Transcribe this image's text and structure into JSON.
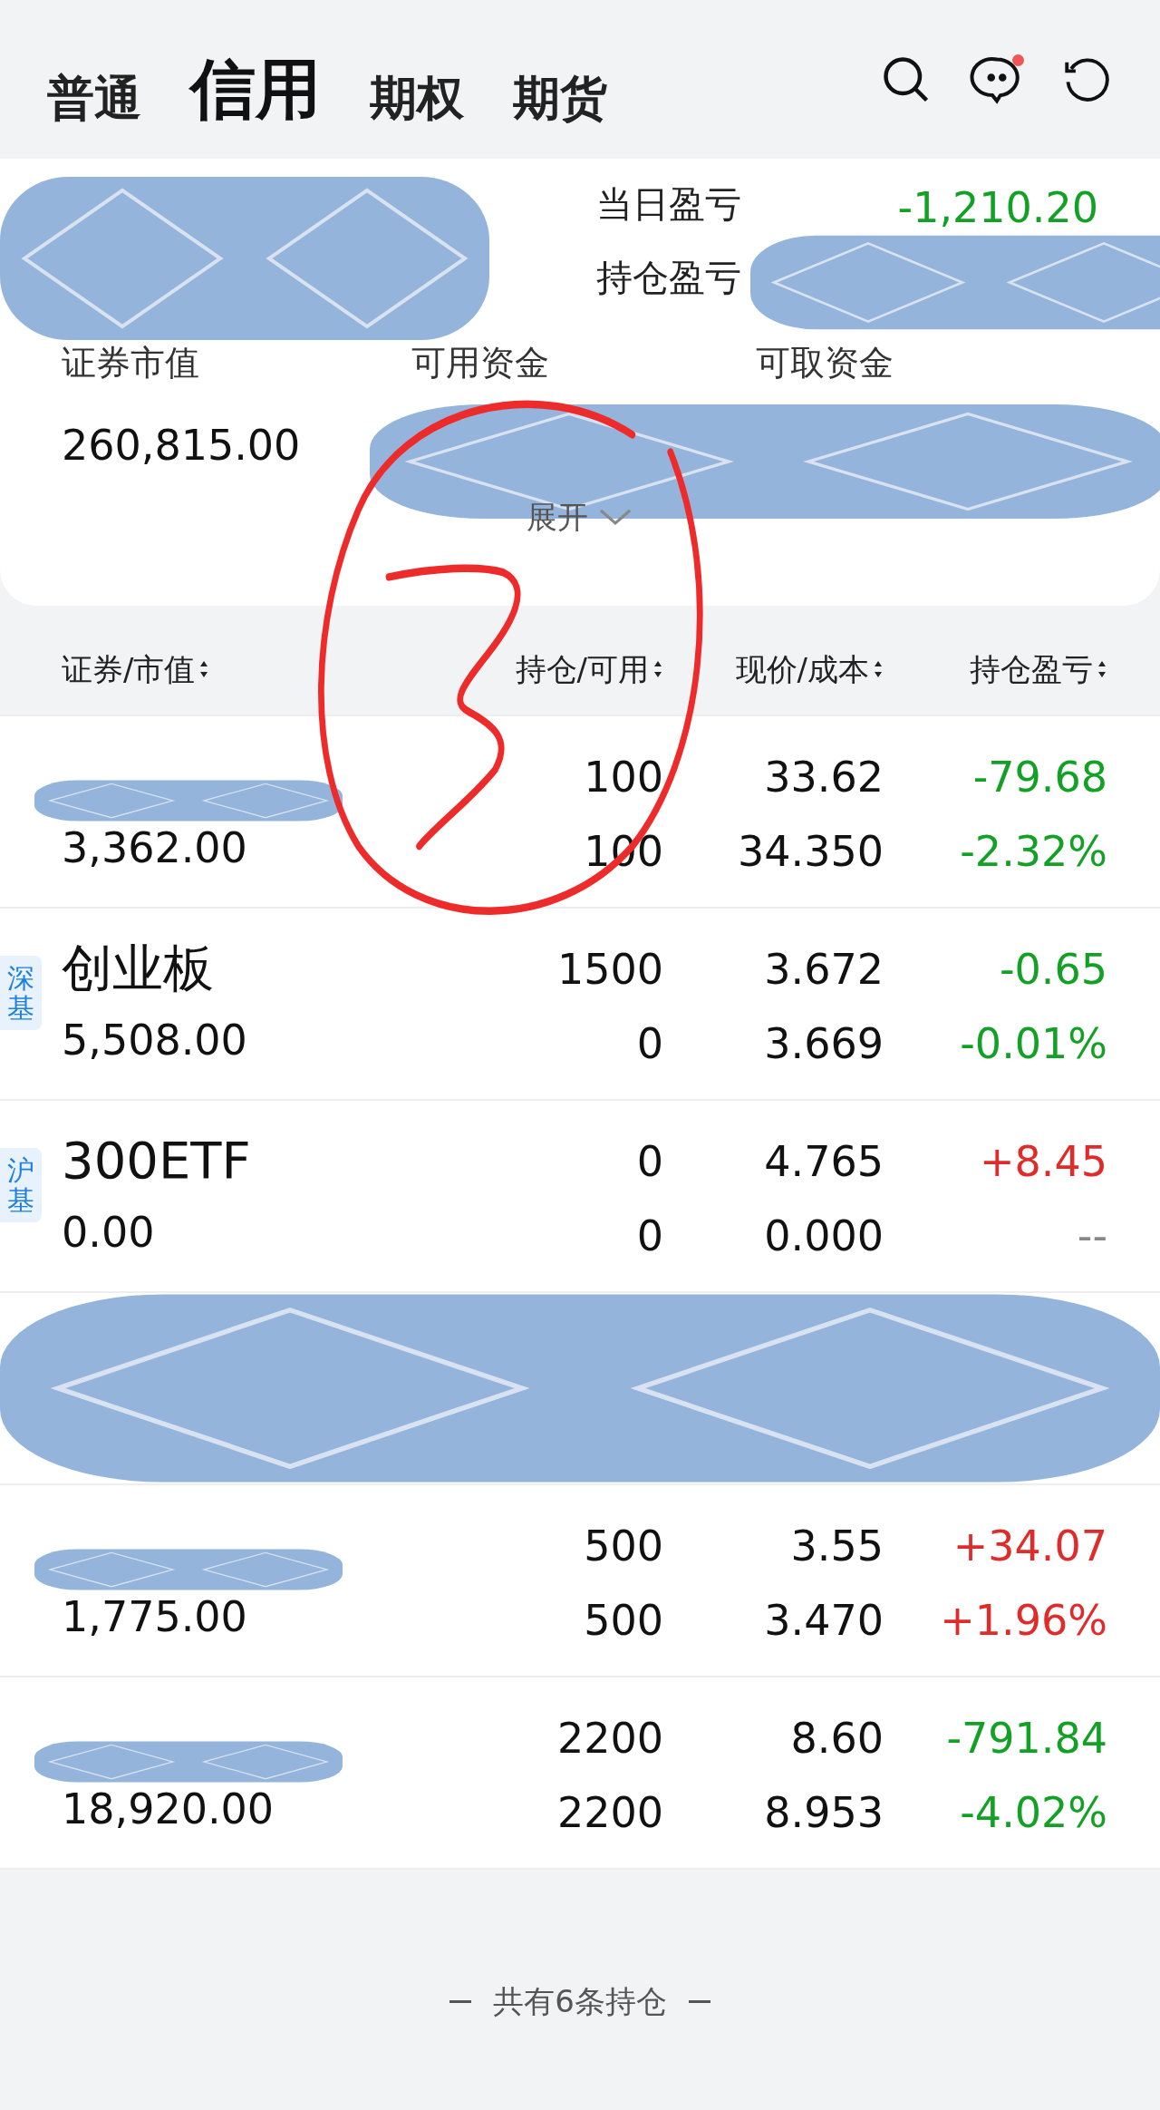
{
  "tabs": [
    {
      "label": "普通",
      "selected": false
    },
    {
      "label": "信用",
      "selected": true
    },
    {
      "label": "期权",
      "selected": false
    },
    {
      "label": "期货",
      "selected": false
    }
  ],
  "header": {
    "has_unread": true
  },
  "summary": {
    "account_redacted": true,
    "daily_pl": {
      "label": "当日盈亏",
      "value": "-1,210.20",
      "color": "#12a125"
    },
    "position_pl": {
      "label": "持仓盈亏",
      "redacted": true
    },
    "metrics": [
      {
        "label": "证券市值",
        "value": "260,815.00"
      },
      {
        "label": "可用资金",
        "redacted": true
      },
      {
        "label": "可取资金",
        "redacted": true
      }
    ],
    "expand": "展开"
  },
  "columns": [
    "证券/市值",
    "持仓/可用",
    "现价/成本",
    "持仓盈亏"
  ],
  "positions": [
    {
      "kind": "position",
      "name_redacted": true,
      "market_value": "3,362.00",
      "holding": "100",
      "available": "100",
      "price": "33.62",
      "cost": "34.350",
      "pl": "-79.68",
      "pl_pct": "-2.32%",
      "color": "#12a125"
    },
    {
      "kind": "position",
      "tag": "深基",
      "name": "创业板",
      "market_value": "5,508.00",
      "holding": "1500",
      "available": "0",
      "price": "3.672",
      "cost": "3.669",
      "pl": "-0.65",
      "pl_pct": "-0.01%",
      "color": "#12a125"
    },
    {
      "kind": "position",
      "tag": "沪基",
      "name": "300ETF",
      "market_value": "0.00",
      "holding": "0",
      "available": "0",
      "price": "4.765",
      "cost": "0.000",
      "pl": "+8.45",
      "pl_pct": "--",
      "color": "#e02b2b",
      "pct_neutral": true
    },
    {
      "kind": "redacted"
    },
    {
      "kind": "position",
      "name_redacted": true,
      "market_value": "1,775.00",
      "holding": "500",
      "available": "500",
      "price": "3.55",
      "cost": "3.470",
      "pl": "+34.07",
      "pl_pct": "+1.96%",
      "color": "#e02b2b"
    },
    {
      "kind": "position",
      "name_redacted": true,
      "market_value": "18,920.00",
      "holding": "2200",
      "available": "2200",
      "price": "8.60",
      "cost": "8.953",
      "pl": "-791.84",
      "pl_pct": "-4.02%",
      "color": "#12a125"
    }
  ],
  "footer": "共有6条持仓"
}
